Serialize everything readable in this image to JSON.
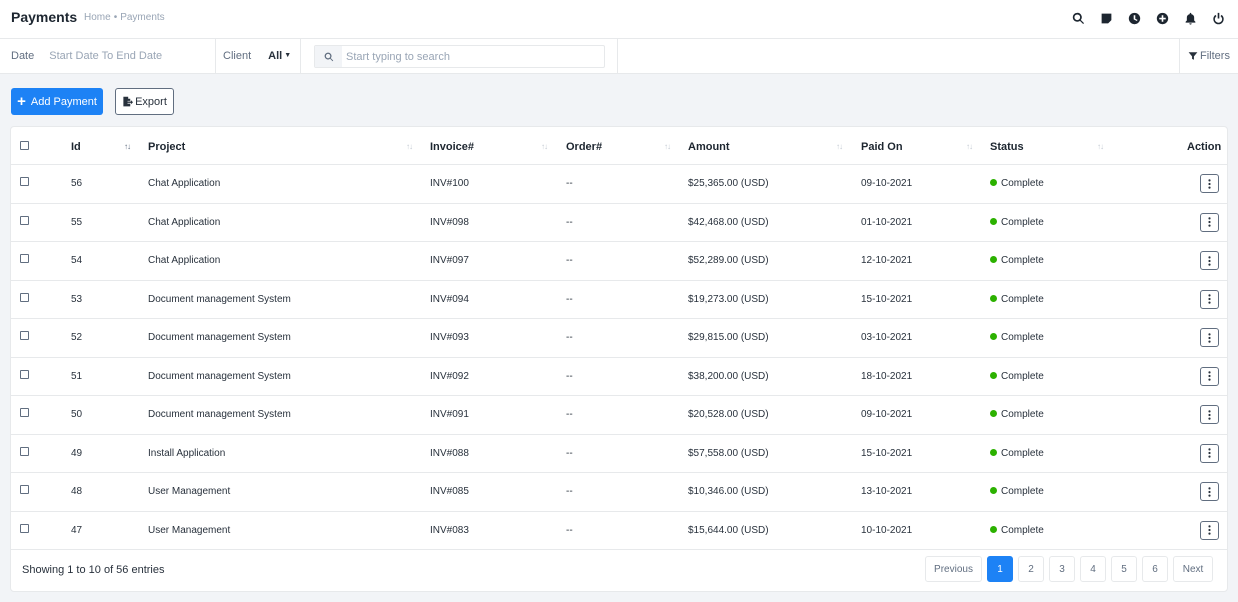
{
  "header": {
    "title": "Payments",
    "breadcrumb": [
      "Home",
      "Payments"
    ],
    "breadcrumb_sep": "•",
    "icons": [
      "search-icon",
      "sticky-note-icon",
      "clock-icon",
      "plus-circle-icon",
      "bell-icon",
      "power-icon"
    ]
  },
  "filters": {
    "date_label": "Date",
    "date_value": "Start Date To End Date",
    "client_label": "Client",
    "client_value": "All",
    "search_placeholder": "Start typing to search",
    "filters_label": "Filters"
  },
  "actions": {
    "add_label": "Add Payment",
    "export_label": "Export"
  },
  "colors": {
    "primary": "#1d82f5",
    "status_complete": "#2cb100"
  },
  "table": {
    "columns": [
      "Id",
      "Project",
      "Invoice#",
      "Order#",
      "Amount",
      "Paid On",
      "Status",
      "Action"
    ],
    "rows": [
      {
        "id": "56",
        "project": "Chat Application",
        "invoice": "INV#100",
        "order": "--",
        "amount": "$25,365.00 (USD)",
        "paid_on": "09-10-2021",
        "status": "Complete"
      },
      {
        "id": "55",
        "project": "Chat Application",
        "invoice": "INV#098",
        "order": "--",
        "amount": "$42,468.00 (USD)",
        "paid_on": "01-10-2021",
        "status": "Complete"
      },
      {
        "id": "54",
        "project": "Chat Application",
        "invoice": "INV#097",
        "order": "--",
        "amount": "$52,289.00 (USD)",
        "paid_on": "12-10-2021",
        "status": "Complete"
      },
      {
        "id": "53",
        "project": "Document management System",
        "invoice": "INV#094",
        "order": "--",
        "amount": "$19,273.00 (USD)",
        "paid_on": "15-10-2021",
        "status": "Complete"
      },
      {
        "id": "52",
        "project": "Document management System",
        "invoice": "INV#093",
        "order": "--",
        "amount": "$29,815.00 (USD)",
        "paid_on": "03-10-2021",
        "status": "Complete"
      },
      {
        "id": "51",
        "project": "Document management System",
        "invoice": "INV#092",
        "order": "--",
        "amount": "$38,200.00 (USD)",
        "paid_on": "18-10-2021",
        "status": "Complete"
      },
      {
        "id": "50",
        "project": "Document management System",
        "invoice": "INV#091",
        "order": "--",
        "amount": "$20,528.00 (USD)",
        "paid_on": "09-10-2021",
        "status": "Complete"
      },
      {
        "id": "49",
        "project": "Install Application",
        "invoice": "INV#088",
        "order": "--",
        "amount": "$57,558.00 (USD)",
        "paid_on": "15-10-2021",
        "status": "Complete"
      },
      {
        "id": "48",
        "project": "User Management",
        "invoice": "INV#085",
        "order": "--",
        "amount": "$10,346.00 (USD)",
        "paid_on": "13-10-2021",
        "status": "Complete"
      },
      {
        "id": "47",
        "project": "User Management",
        "invoice": "INV#083",
        "order": "--",
        "amount": "$15,644.00 (USD)",
        "paid_on": "10-10-2021",
        "status": "Complete"
      }
    ]
  },
  "footer": {
    "showing": "Showing 1 to 10 of 56 entries",
    "prev_label": "Previous",
    "next_label": "Next",
    "pages": [
      "1",
      "2",
      "3",
      "4",
      "5",
      "6"
    ],
    "current_page": "1"
  }
}
